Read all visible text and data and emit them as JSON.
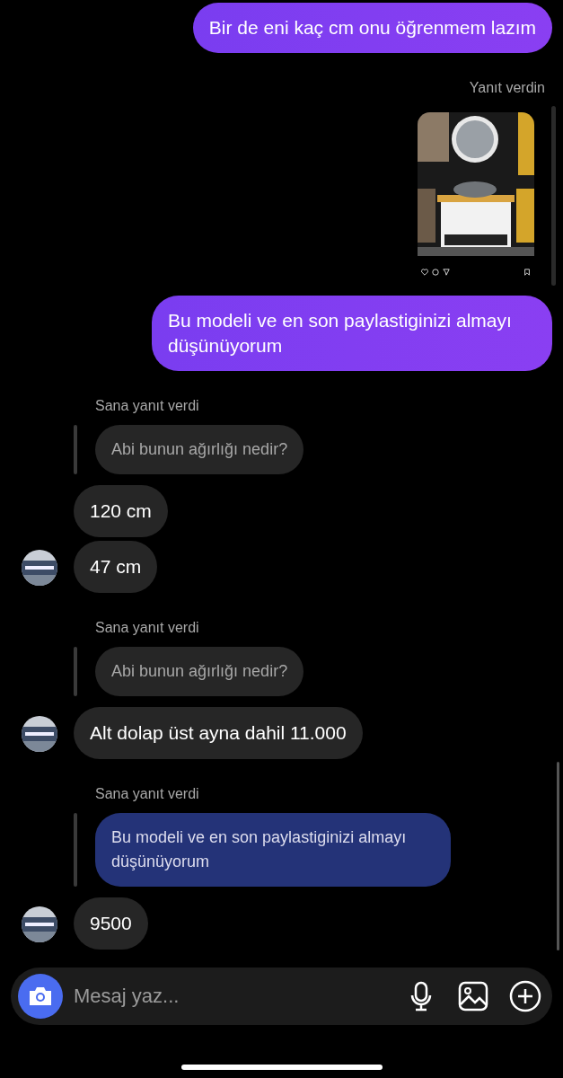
{
  "messages": [
    {
      "kind": "outgoing",
      "text": "Bir de eni kaç cm onu öğrenmem lazım"
    },
    {
      "kind": "reply_label",
      "mine": true,
      "text": "Yanıt verdin"
    },
    {
      "kind": "shared_post"
    },
    {
      "kind": "outgoing",
      "text": "Bu modeli ve en son paylastiginizi almayı düşünüyorum"
    },
    {
      "kind": "reply_label",
      "mine": false,
      "text": "Sana yanıt verdi"
    },
    {
      "kind": "quoted",
      "own": false,
      "text": "Abi bunun ağırlığı nedir?"
    },
    {
      "kind": "incoming",
      "avatar": false,
      "text": "120 cm"
    },
    {
      "kind": "incoming",
      "avatar": true,
      "text": "47 cm"
    },
    {
      "kind": "reply_label",
      "mine": false,
      "text": "Sana yanıt verdi"
    },
    {
      "kind": "quoted",
      "own": false,
      "text": "Abi bunun ağırlığı nedir?"
    },
    {
      "kind": "incoming",
      "avatar": true,
      "text": "Alt dolap üst ayna dahil 11.000"
    },
    {
      "kind": "reply_label",
      "mine": false,
      "text": "Sana yanıt verdi"
    },
    {
      "kind": "quoted",
      "own": true,
      "text": "Bu modeli ve en son paylastiginizi almayı düşünüyorum"
    },
    {
      "kind": "incoming",
      "avatar": true,
      "text": "9500"
    }
  ],
  "composer": {
    "placeholder": "Mesaj yaz..."
  }
}
